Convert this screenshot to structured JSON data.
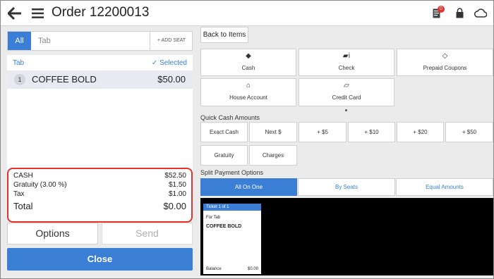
{
  "header": {
    "title": "Order 12200013",
    "badge_count": "0"
  },
  "left": {
    "tab_all": "All",
    "tab_placeholder": "Tab",
    "add_seat": "+ ADD SEAT",
    "tab_label": "Tab",
    "selected_label": "✓ Selected",
    "items": [
      {
        "seat": "1",
        "name": "COFFEE BOLD",
        "price": "$50.00"
      }
    ],
    "totals": {
      "cash_label": "CASH",
      "cash_value": "$52.50",
      "gratuity_label": "Gratuity (3.00 %)",
      "gratuity_value": "$1.50",
      "tax_label": "Tax",
      "tax_value": "$1.00",
      "total_label": "Total",
      "total_value": "$0.00"
    },
    "options_label": "Options",
    "send_label": "Send",
    "close_label": "Close"
  },
  "right": {
    "back_to_items": "Back to Items",
    "payment_methods": [
      {
        "label": "Cash",
        "icon": "cash-icon"
      },
      {
        "label": "Check",
        "icon": "check-icon"
      },
      {
        "label": "Prepaid Coupons",
        "icon": "coupon-icon"
      },
      {
        "label": "House Account",
        "icon": "home-icon"
      },
      {
        "label": "Credit Card",
        "icon": "credit-card-icon"
      }
    ],
    "quick_cash_label": "Quick Cash Amounts",
    "quick_cash": [
      "Exact Cash",
      "Next $",
      "+ $5",
      "+ $10",
      "+ $20",
      "+ $50"
    ],
    "extras": [
      "Gratuity",
      "Charges"
    ],
    "split_label": "Split Payment Options",
    "split_options": [
      "All On One",
      "By Seats",
      "Equal Amounts"
    ],
    "ticket": {
      "header": "Ticket 1 of 1",
      "for": "For Tab",
      "item": "COFFEE BOLD",
      "balance_label": "Balance",
      "balance_value": "$0.00"
    }
  },
  "colors": {
    "accent": "#3a7fd5",
    "highlight": "#e5322d"
  }
}
